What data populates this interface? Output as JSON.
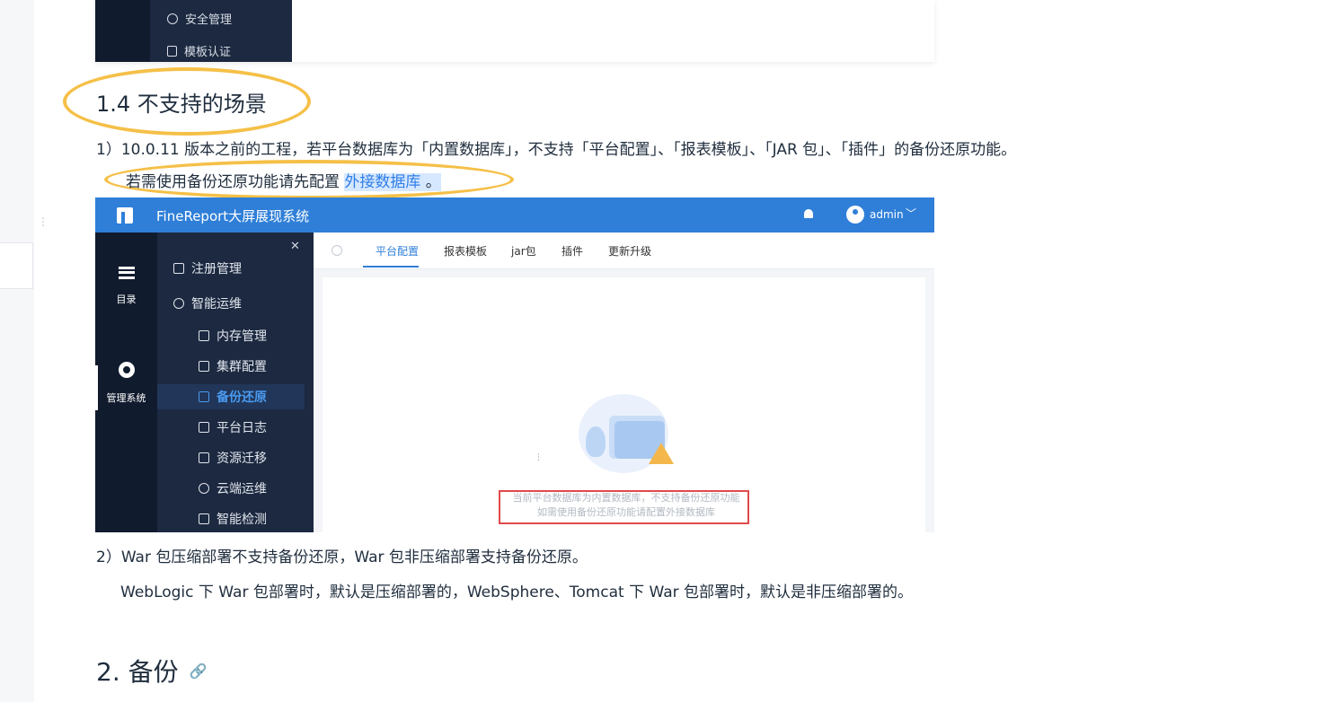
{
  "top_fragment": {
    "items": [
      {
        "icon": "shield-plus-icon",
        "label": "安全管理"
      },
      {
        "icon": "document-check-icon",
        "label": "模板认证"
      }
    ]
  },
  "section_1_4": {
    "heading": "1.4 不支持的场景",
    "para1": "1）10.0.11 版本之前的工程，若平台数据库为「内置数据库」，不支持「平台配置」、「报表模板」、「JAR 包」、「插件」的备份还原功能。",
    "para1b_prefix": "若需使用备份还原功能请先配置 ",
    "para1b_link": "外接数据库",
    "para1b_suffix": " 。",
    "para2": "2）War 包压缩部署不支持备份还原，War 包非压缩部署支持备份还原。",
    "para2b": "WebLogic 下 War 包部署时，默认是压缩部署的，WebSphere、Tomcat 下 War 包部署时，默认是非压缩部署的。"
  },
  "screenshot": {
    "app_title": "FineReport大屏展现系统",
    "user": "admin",
    "side_tabs": [
      {
        "icon": "list-icon",
        "label": "目录"
      },
      {
        "icon": "gear-icon",
        "label": "管理系统"
      }
    ],
    "menu": [
      {
        "label": "注册管理"
      },
      {
        "label": "智能运维"
      },
      {
        "label": "内存管理"
      },
      {
        "label": "集群配置"
      },
      {
        "label": "备份还原"
      },
      {
        "label": "平台日志"
      },
      {
        "label": "资源迁移"
      },
      {
        "label": "云端运维"
      },
      {
        "label": "智能检测"
      }
    ],
    "tabs": [
      "平台配置",
      "报表模板",
      "jar包",
      "插件",
      "更新升级"
    ],
    "message_line1": "当前平台数据库为内置数据库，不支持备份还原功能",
    "message_line2": "如需使用备份还原功能请配置外接数据库"
  },
  "section_2": {
    "heading": "2. 备份"
  },
  "colors": {
    "accent": "#2f7fd8",
    "highlight_oval": "#f5c048",
    "sidebar_dark": "#111b2e",
    "sidebar": "#1c2940"
  }
}
